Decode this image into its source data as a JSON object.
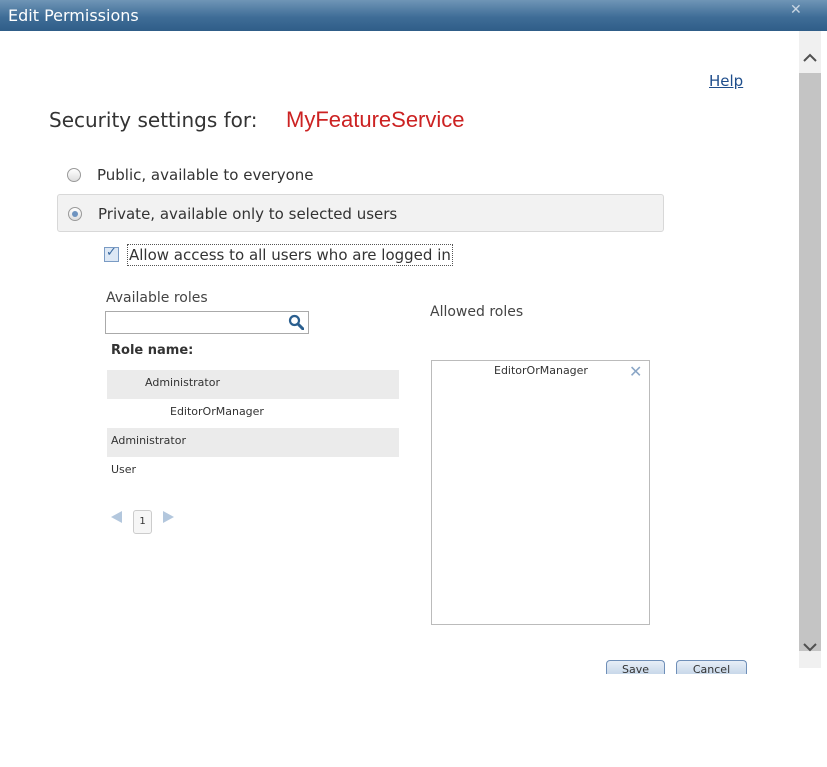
{
  "window": {
    "title": "Edit Permissions",
    "close_glyph": "✕"
  },
  "help_link": "Help",
  "security": {
    "label": "Security settings for:",
    "service_name": "MyFeatureService"
  },
  "access_options": [
    {
      "label": "Public, available to everyone",
      "selected": false
    },
    {
      "label": "Private, available only to selected users",
      "selected": true
    }
  ],
  "allow_logged_in": {
    "label": "Allow access to all users who are logged in",
    "checked": true
  },
  "available_roles": {
    "heading": "Available roles",
    "search_placeholder": "",
    "column_header": "Role name:",
    "rows": [
      "Administrator",
      "EditorOrManager",
      "Administrator",
      "User"
    ]
  },
  "pagination": {
    "current_page": "1"
  },
  "allowed_roles": {
    "heading": "Allowed roles",
    "items": [
      "EditorOrManager"
    ],
    "remove_glyph": "✕"
  },
  "buttons": {
    "save_label": "Save",
    "cancel_label": "Cancel"
  },
  "colors": {
    "title_bar": "#3f6d97",
    "service_name": "#cc2222",
    "link": "#1f4e8c"
  }
}
